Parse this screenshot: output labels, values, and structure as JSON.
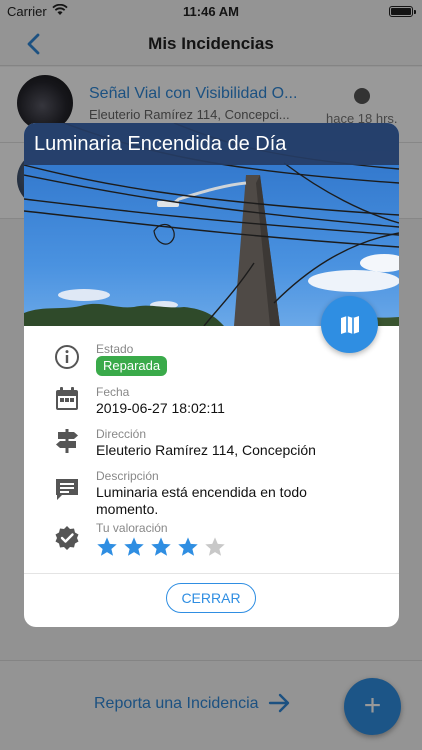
{
  "status_bar": {
    "carrier": "Carrier",
    "time": "11:46 AM"
  },
  "nav": {
    "title": "Mis Incidencias"
  },
  "list": {
    "items": [
      {
        "title": "Señal Vial con Visibilidad O...",
        "address": "Eleuterio Ramírez 114, Concepci...",
        "time": "hace 18 hrs."
      },
      {
        "title": "",
        "address": "",
        "time": ""
      }
    ]
  },
  "bottom": {
    "report_label": "Reporta una Incidencia",
    "fab_label": "+"
  },
  "modal": {
    "title": "Luminaria Encendida de Día",
    "estado": {
      "label": "Estado",
      "value": "Reparada",
      "color": "#3aaa4a"
    },
    "fecha": {
      "label": "Fecha",
      "value": "2019-06-27 18:02:11"
    },
    "direccion": {
      "label": "Dirección",
      "value": "Eleuterio Ramírez 114, Concepción"
    },
    "descripcion": {
      "label": "Descripción",
      "value": "Luminaria está encendida en todo momento."
    },
    "valoracion": {
      "label": "Tu valoración",
      "rating": 4,
      "max": 5
    },
    "close_label": "CERRAR"
  },
  "colors": {
    "accent": "#2f8ee2",
    "title_bar": "#253c64",
    "success": "#3aaa4a"
  }
}
